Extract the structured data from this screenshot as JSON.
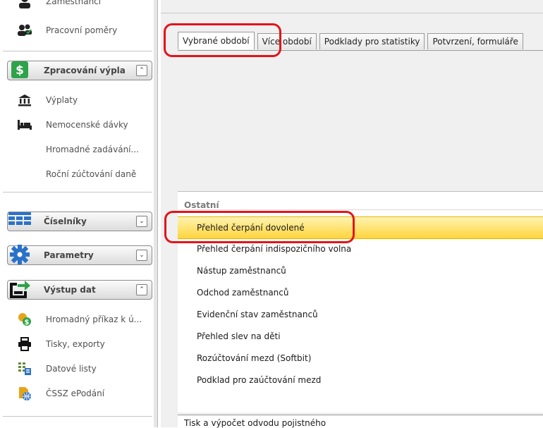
{
  "sidebar": {
    "top_cut_label": "Zaměstnanci",
    "pracovni_pomery": "Pracovní poměry",
    "groups": {
      "zpracovani": {
        "label": "Zpracování výpla",
        "toggle": "⌃",
        "items": [
          "Výplaty",
          "Nemocenské dávky",
          "Hromadné zadávání...",
          "Roční zúčtování daně"
        ]
      },
      "ciselniky": {
        "label": "Číselníky",
        "toggle": "⌄"
      },
      "parametry": {
        "label": "Parametry",
        "toggle": "⌄"
      },
      "vystup": {
        "label": "Výstup dat",
        "toggle": "⌃",
        "items": [
          "Hromadný příkaz k ú...",
          "Tisky, exporty",
          "Datové listy",
          "ČSSZ ePodání"
        ]
      }
    }
  },
  "tabs": [
    "Vybrané období",
    "Více období",
    "Podklady pro statistiky",
    "Potvrzení, formuláře"
  ],
  "list": {
    "header": "Ostatní",
    "items": [
      "Přehled čerpání dovolené",
      "Přehled čerpání indispozičního volna",
      "Nástup zaměstnanců",
      "Odchod zaměstnanců",
      "Evidenční stav zaměstnanců",
      "Přehled slev na děti",
      "Rozúčtování mezd (Softbit)",
      "Podklad pro zaúčtování mezd"
    ]
  },
  "footer": {
    "label": "Tisk a výpočet odvodu pojistného"
  },
  "colors": {
    "highlight": "#e3141b",
    "selected_row": "#ffd43d",
    "group_icon_green": "#2ea34a"
  }
}
